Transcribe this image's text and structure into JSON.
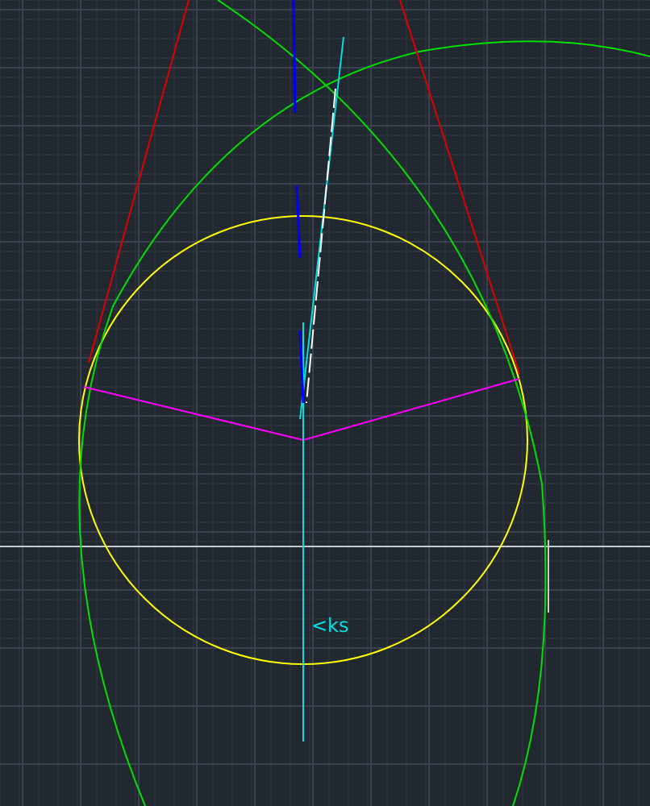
{
  "canvas": {
    "label": "<ks"
  }
}
